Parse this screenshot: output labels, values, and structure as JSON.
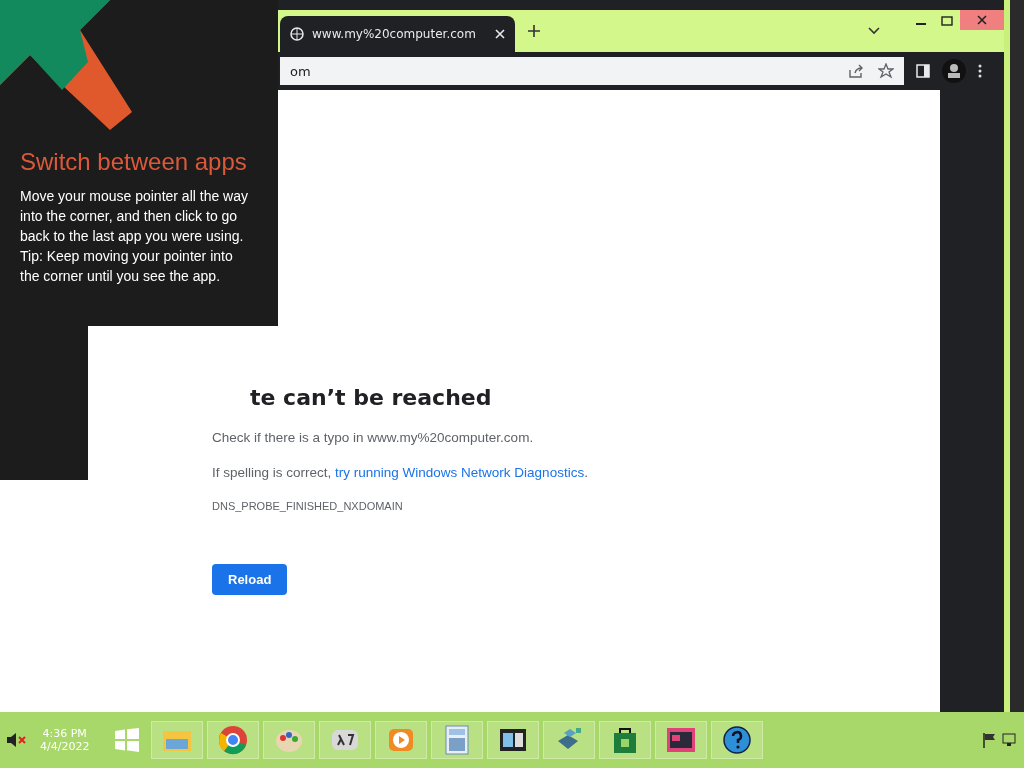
{
  "tip": {
    "title": "Switch between apps",
    "paragraphs": [
      "Move your mouse pointer all the way into the corner, and then click to go back to the last app you were using.",
      "Tip: Keep moving your pointer into the corner until you see the app."
    ]
  },
  "browser": {
    "tab": {
      "title": "www.my%20computer.com",
      "selected": true
    },
    "address": "om"
  },
  "error_page": {
    "heading": "te can’t be reached",
    "typo_line": "Check if there is a typo in www.my%20computer.com.",
    "diagnostics_prefix": "If spelling is correct, ",
    "diagnostics_link": "try running Windows Network Diagnostics",
    "diagnostics_suffix": ".",
    "error_code": "DNS_PROBE_FINISHED_NXDOMAIN",
    "reload_button": "Reload"
  },
  "taskbar": {
    "time": "4:36 PM",
    "date": "4/4/2022",
    "apps": [
      {
        "kind": "folder"
      },
      {
        "kind": "browser"
      },
      {
        "kind": "paint"
      },
      {
        "kind": "math"
      },
      {
        "kind": "media"
      },
      {
        "kind": "calculator"
      },
      {
        "kind": "window"
      },
      {
        "kind": "cubes"
      },
      {
        "kind": "store"
      },
      {
        "kind": "news"
      },
      {
        "kind": "help"
      }
    ]
  }
}
